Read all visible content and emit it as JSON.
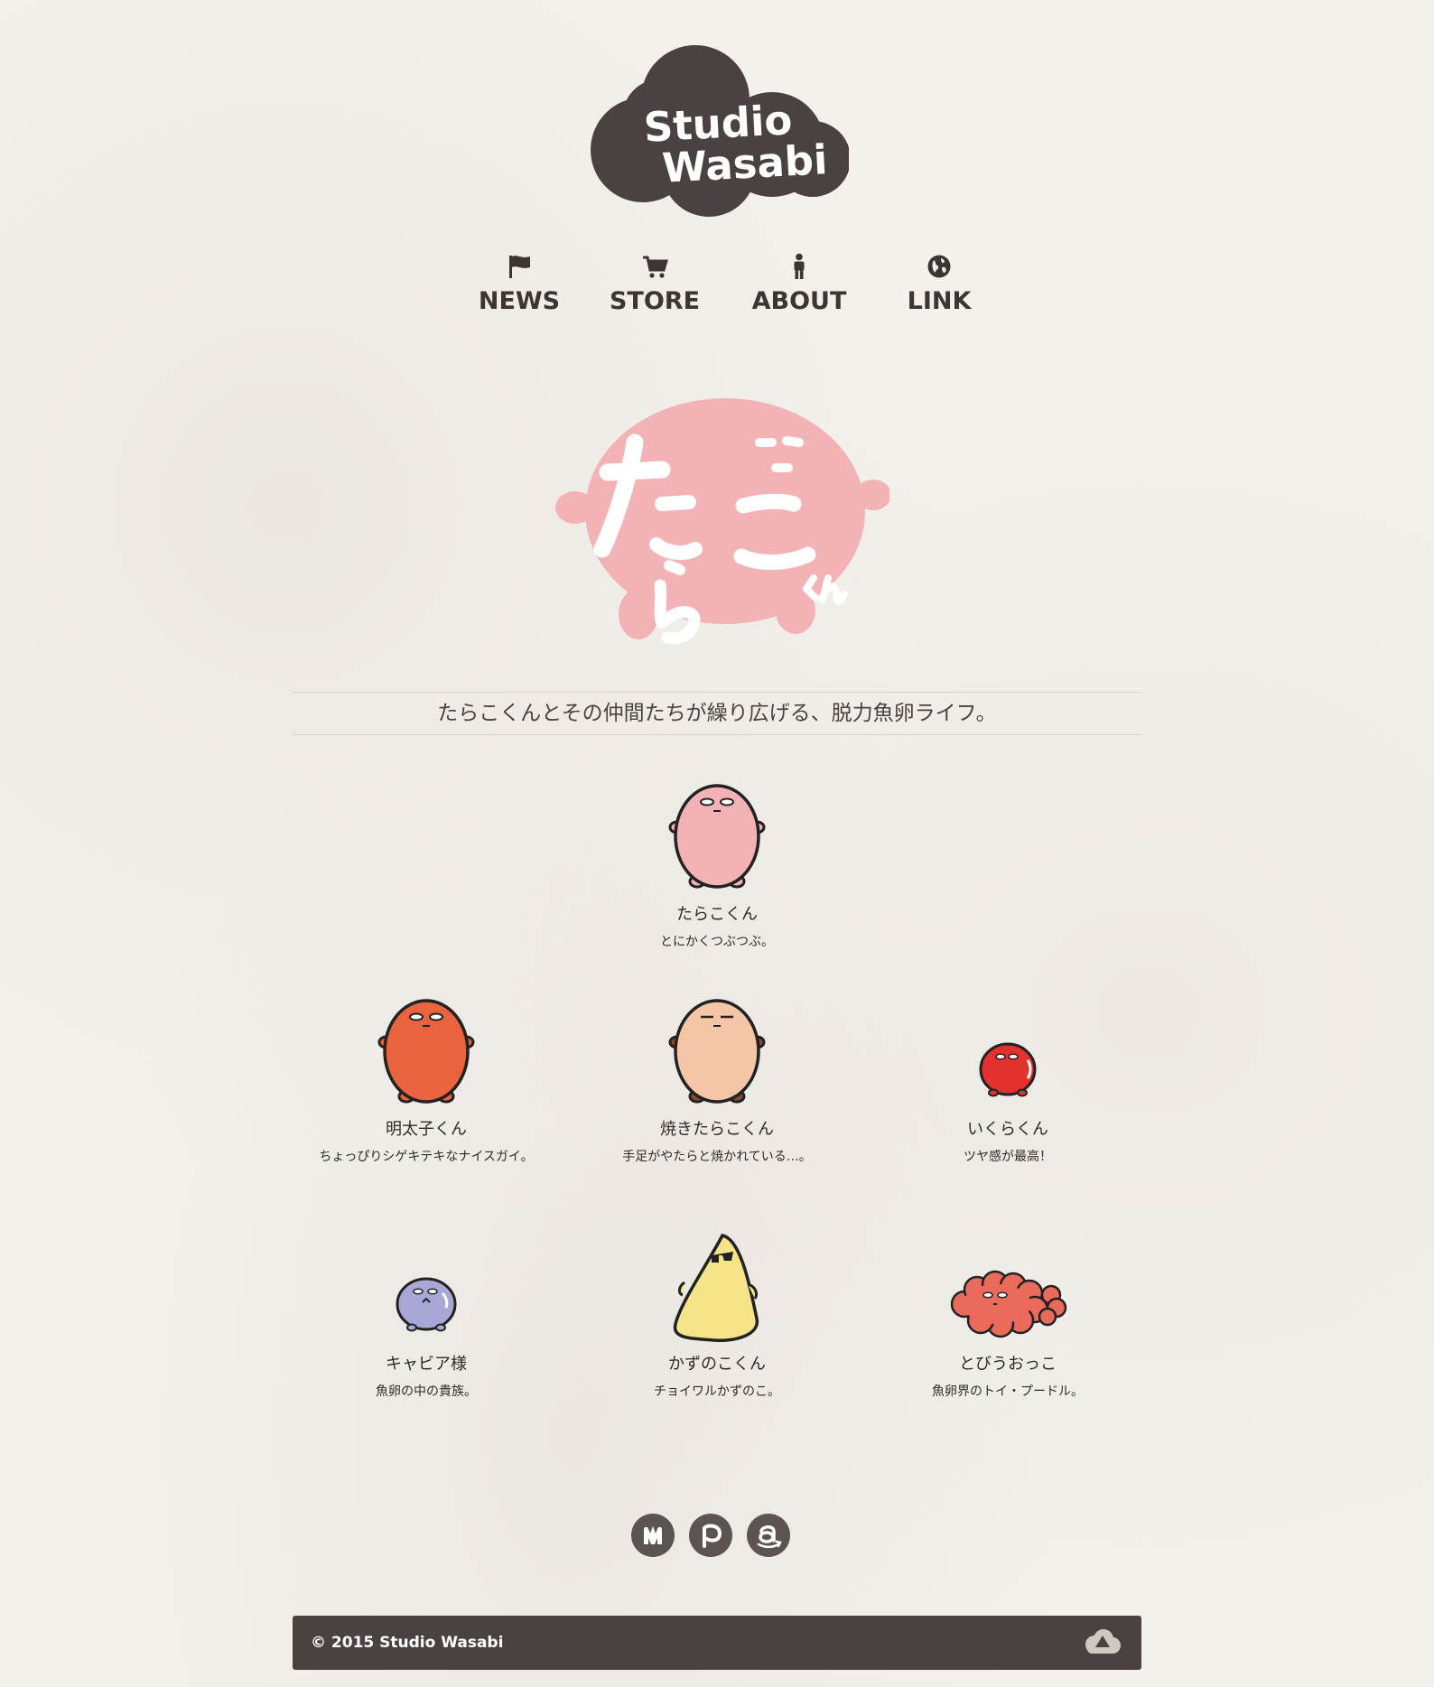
{
  "logo": {
    "line1": "Studio",
    "line2": "Wasabi"
  },
  "nav": [
    {
      "label": "NEWS",
      "icon": "flag-icon"
    },
    {
      "label": "STORE",
      "icon": "cart-icon"
    },
    {
      "label": "ABOUT",
      "icon": "person-icon"
    },
    {
      "label": "LINK",
      "icon": "globe-icon"
    }
  ],
  "hero": {
    "title": "たらこくん",
    "icon": "tarako-logo"
  },
  "tagline": "たらこくんとその仲間たちが繰り広げる、脱力魚卵ライフ。",
  "characters": [
    {
      "name": "たらこくん",
      "desc": "とにかくつぶつぶ。",
      "color": "#f3b2b5"
    },
    {
      "name": "明太子くん",
      "desc": "ちょっぴりシゲキテキなナイスガイ。",
      "color": "#e9643e"
    },
    {
      "name": "焼きたらこくん",
      "desc": "手足がやたらと焼かれている…。",
      "color": "#f5c6a5"
    },
    {
      "name": "いくらくん",
      "desc": "ツヤ感が最高！",
      "color": "#e53030"
    },
    {
      "name": "キャビア様",
      "desc": "魚卵の中の貴族。",
      "color": "#a9a7d6"
    },
    {
      "name": "かずのこくん",
      "desc": "チョイワルかずのこ。",
      "color": "#f5e488"
    },
    {
      "name": "とびうおっこ",
      "desc": "魚卵界のトイ・プードル。",
      "color": "#ea6b5b"
    }
  ],
  "social": [
    {
      "icon": "hatena-icon"
    },
    {
      "icon": "pixiv-icon"
    },
    {
      "icon": "amazon-icon"
    }
  ],
  "footer": {
    "copyright": "© 2015 Studio Wasabi",
    "top_icon": "cloud-up-icon"
  },
  "colors": {
    "dark": "#4a4241",
    "background": "#f4f1ed",
    "tarako_pink": "#f3b2b5"
  }
}
